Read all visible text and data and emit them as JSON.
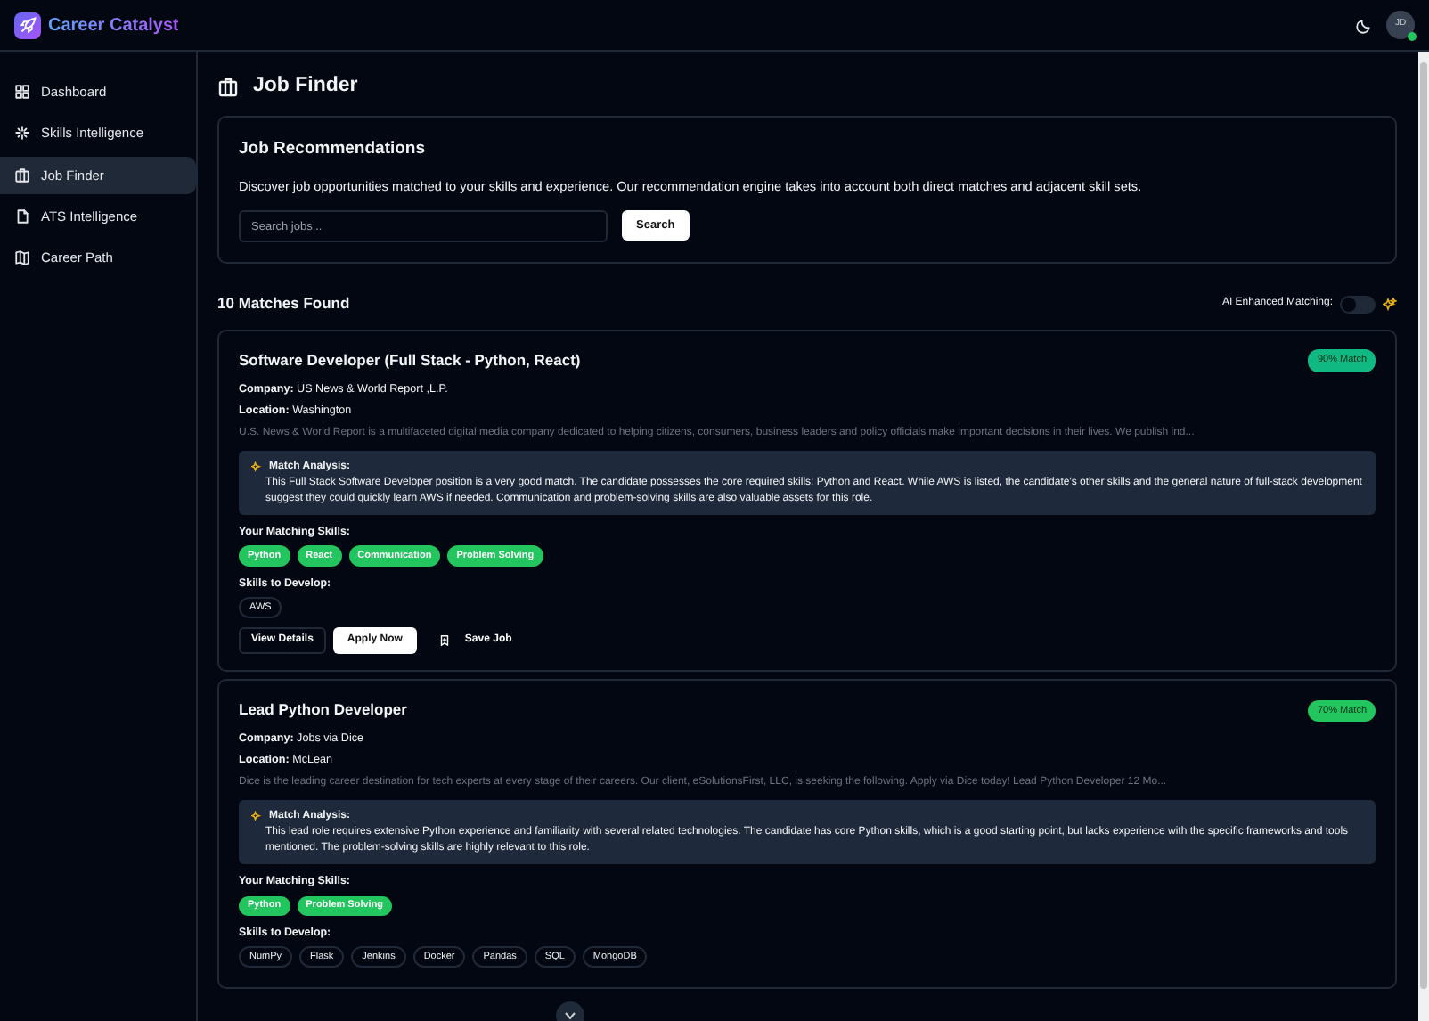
{
  "app": {
    "name": "Career Catalyst"
  },
  "header": {
    "avatar": {
      "initials": "JD",
      "online": true
    }
  },
  "sidebar": {
    "items": [
      {
        "label": "Dashboard",
        "selected": false
      },
      {
        "label": "Skills Intelligence",
        "selected": false
      },
      {
        "label": "Job Finder",
        "selected": true
      },
      {
        "label": "ATS Intelligence",
        "selected": false
      },
      {
        "label": "Career Path",
        "selected": false
      }
    ]
  },
  "page": {
    "title": "Job Finder"
  },
  "recommendations": {
    "title": "Job Recommendations",
    "description": "Discover job opportunities matched to your skills and experience. Our recommendation engine takes into account both direct matches and adjacent skill sets.",
    "search": {
      "placeholder": "Search jobs..."
    },
    "button": "Search"
  },
  "results": {
    "count": "10 Matches Found",
    "ai_toggle": {
      "label": "AI Enhanced Matching:",
      "on": false
    }
  },
  "jobs": [
    {
      "title": "Software Developer (Full Stack - Python, React)",
      "match": "90% Match",
      "company_label": "Company:",
      "company": "US News & World Report ,L.P.",
      "location_label": "Location:",
      "location": "Washington",
      "description": "U.S. News & World Report is a multifaceted digital media company dedicated to helping citizens, consumers, business leaders and policy officials make important decisions in their lives. We publish ind...",
      "analysis_title": "Match Analysis:",
      "analysis": "This Full Stack Software Developer position is a very good match. The candidate possesses the core required skills: Python and React. While AWS is listed, the candidate's other skills and the general nature of full-stack development suggest they could quickly learn AWS if needed. Communication and problem-solving skills are also valuable assets for this role.",
      "matching_label": "Your Matching Skills:",
      "matching_skills": [
        "Python",
        "React",
        "Communication",
        "Problem Solving"
      ],
      "develop_label": "Skills to Develop:",
      "develop_skills": [
        "AWS"
      ],
      "actions": {
        "details": "View Details",
        "apply": "Apply Now",
        "save": "Save Job"
      }
    },
    {
      "title": "Lead Python Developer",
      "match": "70% Match",
      "company_label": "Company:",
      "company": "Jobs via Dice",
      "location_label": "Location:",
      "location": "McLean",
      "description": "Dice is the leading career destination for tech experts at every stage of their careers. Our client, eSolutionsFirst, LLC, is seeking the following. Apply via Dice today! Lead Python Developer 12 Mo...",
      "analysis_title": "Match Analysis:",
      "analysis": "This lead role requires extensive Python experience and familiarity with several related technologies. The candidate has core Python skills, which is a good starting point, but lacks experience with the specific frameworks and tools mentioned. The problem-solving skills are highly relevant to this role.",
      "matching_label": "Your Matching Skills:",
      "matching_skills": [
        "Python",
        "Problem Solving"
      ],
      "develop_label": "Skills to Develop:",
      "develop_skills": [
        "NumPy",
        "Flask",
        "Jenkins",
        "Docker",
        "Pandas",
        "SQL",
        "MongoDB"
      ]
    }
  ]
}
